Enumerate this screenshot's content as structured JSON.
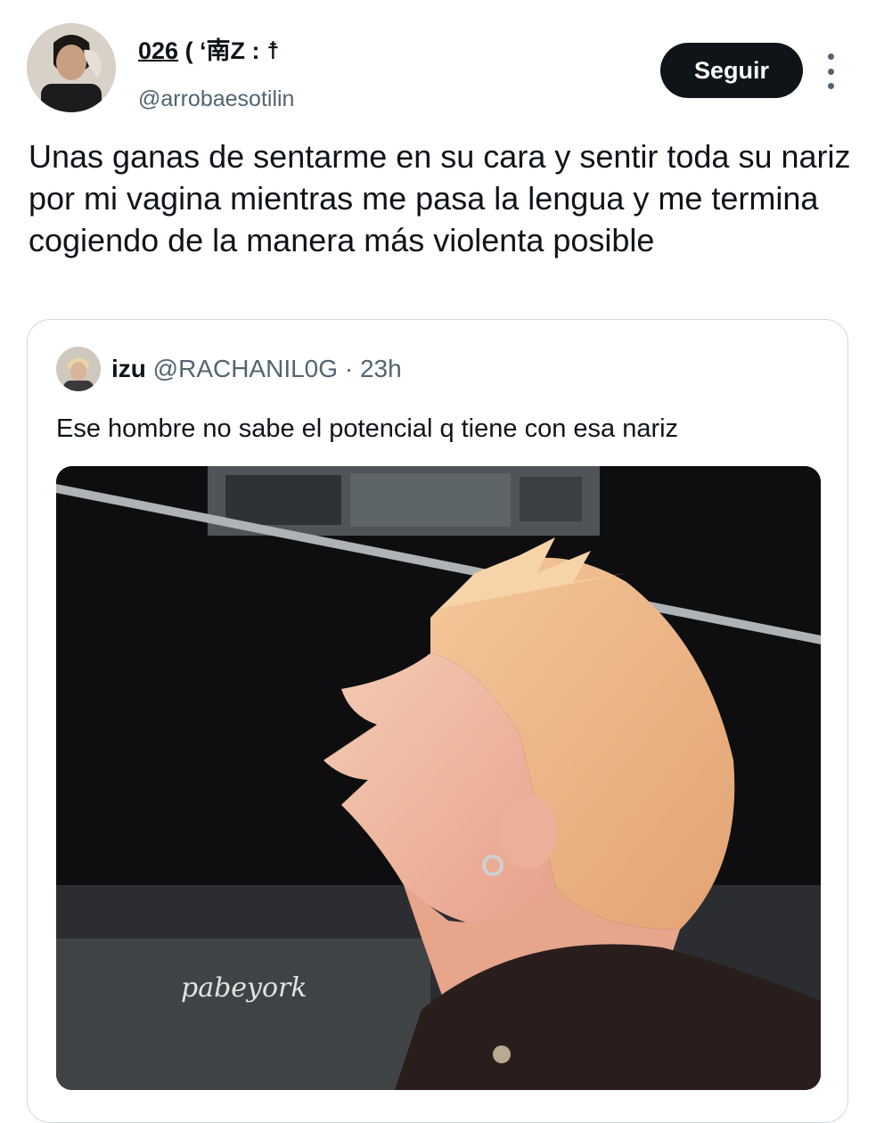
{
  "author": {
    "display_name_prefix": "026",
    "display_name_suffix": " ( ‘南Z : ☨",
    "handle": "@arrobaesotilin",
    "follow_label": "Seguir"
  },
  "tweet": {
    "text": "Unas ganas de sentarme en su cara y sentir toda su nariz por mi vagina mientras me pasa la lengua y me termina cogiendo de la manera más violenta posible"
  },
  "quoted": {
    "name": "izu",
    "handle": "@RACHANIL0G",
    "dot": " · ",
    "time": "23h",
    "text": "Ese hombre no sabe el potencial q tiene con esa nariz",
    "media_watermark": "pabeyork"
  },
  "colors": {
    "text_primary": "#0f1419",
    "text_secondary": "#536471",
    "button_bg": "#0f1419",
    "border": "#cfd9de"
  },
  "icons": {
    "more": "more-vertical-icon"
  }
}
